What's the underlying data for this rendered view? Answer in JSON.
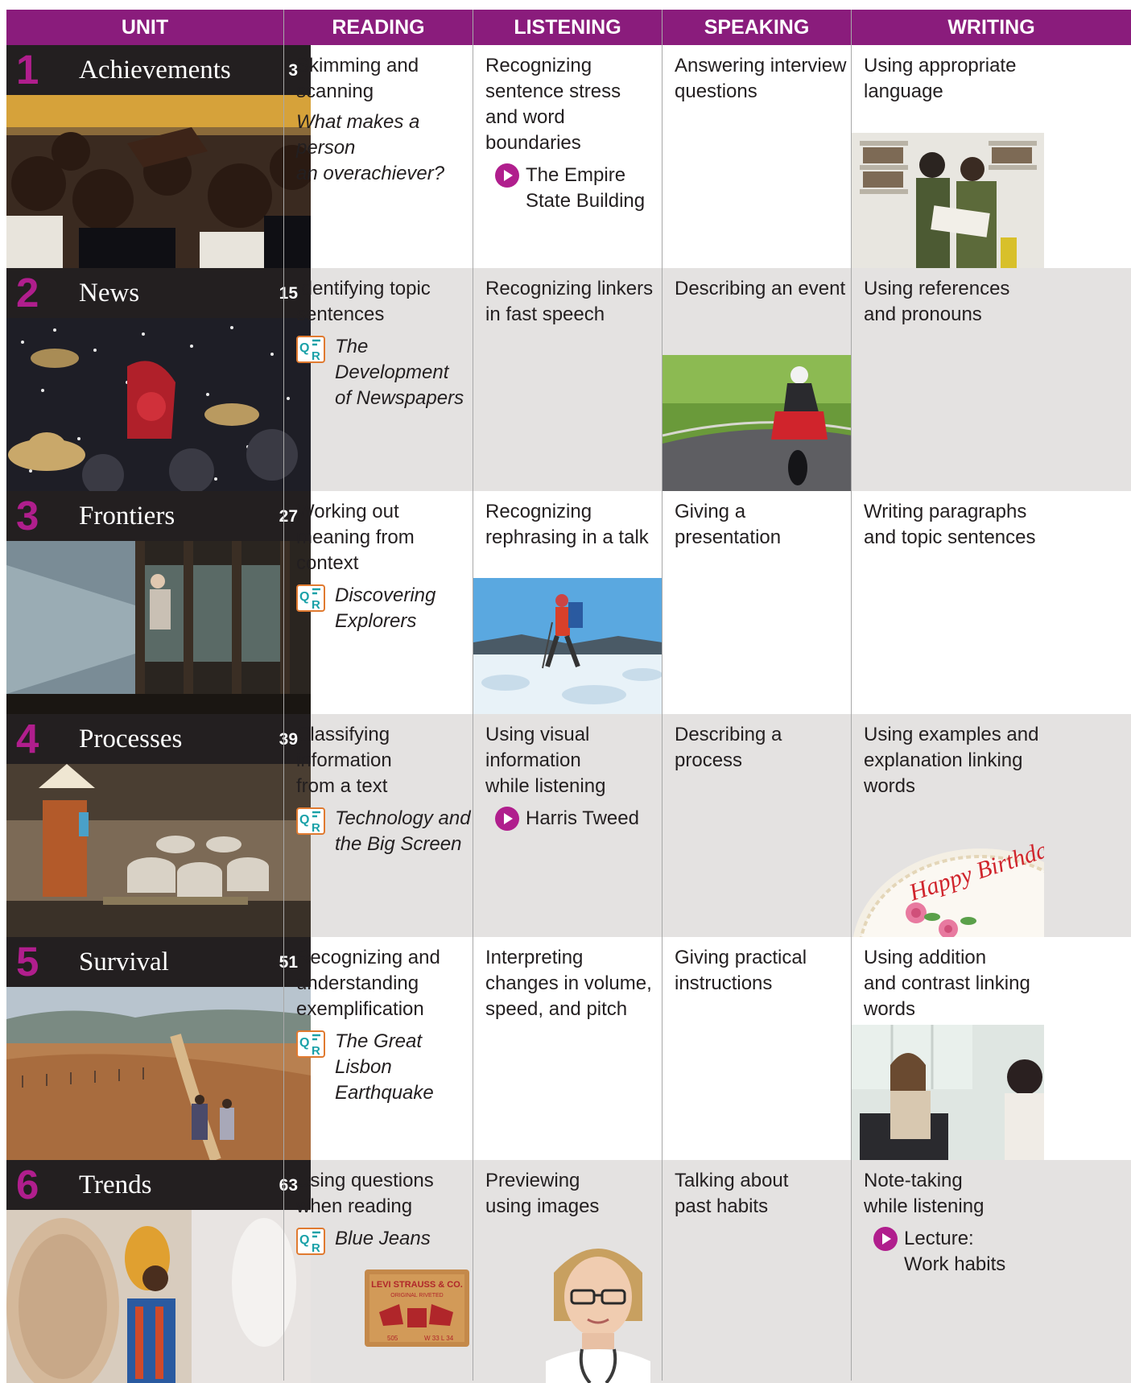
{
  "columns": [
    "UNIT",
    "READING",
    "LISTENING",
    "SPEAKING",
    "WRITING"
  ],
  "units": [
    {
      "number": "1",
      "title": "Achievements",
      "page": "3",
      "reading": {
        "skill": [
          "Skimming and",
          "scanning"
        ],
        "italic": [
          "What makes a person",
          "an overachiever?"
        ],
        "qr": []
      },
      "listening": {
        "skill": [
          "Recognizing",
          "sentence stress",
          "and word",
          "boundaries"
        ],
        "video": [
          "The Empire",
          "State Building"
        ]
      },
      "speaking": {
        "skill": [
          "Answering interview",
          "questions"
        ]
      },
      "writing": {
        "skill": [
          "Using appropriate",
          "language"
        ],
        "video": []
      }
    },
    {
      "number": "2",
      "title": "News",
      "page": "15",
      "reading": {
        "skill": [
          "Identifying topic",
          "sentences"
        ],
        "italic": [],
        "qr": [
          "The",
          "Development",
          "of Newspapers"
        ]
      },
      "listening": {
        "skill": [
          "Recognizing linkers",
          "in fast speech"
        ],
        "video": []
      },
      "speaking": {
        "skill": [
          "Describing an event"
        ]
      },
      "writing": {
        "skill": [
          "Using references",
          "and pronouns"
        ],
        "video": []
      }
    },
    {
      "number": "3",
      "title": "Frontiers",
      "page": "27",
      "reading": {
        "skill": [
          "Working out",
          "meaning from",
          "context"
        ],
        "italic": [],
        "qr": [
          "Discovering",
          "Explorers"
        ]
      },
      "listening": {
        "skill": [
          "Recognizing",
          "rephrasing in a talk"
        ],
        "video": []
      },
      "speaking": {
        "skill": [
          "Giving a",
          "presentation"
        ]
      },
      "writing": {
        "skill": [
          "Writing paragraphs",
          "and topic sentences"
        ],
        "video": []
      }
    },
    {
      "number": "4",
      "title": "Processes",
      "page": "39",
      "reading": {
        "skill": [
          "Classifying",
          "information",
          "from a text"
        ],
        "italic": [],
        "qr": [
          "Technology and",
          "the Big Screen"
        ]
      },
      "listening": {
        "skill": [
          "Using visual",
          "information",
          "while listening"
        ],
        "video": [
          "Harris Tweed"
        ]
      },
      "speaking": {
        "skill": [
          "Describing a process"
        ]
      },
      "writing": {
        "skill": [
          "Using examples and",
          "explanation linking",
          "words"
        ],
        "video": []
      }
    },
    {
      "number": "5",
      "title": "Survival",
      "page": "51",
      "reading": {
        "skill": [
          "Recognizing and",
          "understanding",
          "exemplification"
        ],
        "italic": [],
        "qr": [
          "The Great Lisbon",
          "Earthquake"
        ]
      },
      "listening": {
        "skill": [
          "Interpreting",
          "changes in volume,",
          "speed, and pitch"
        ],
        "video": []
      },
      "speaking": {
        "skill": [
          "Giving practical",
          "instructions"
        ]
      },
      "writing": {
        "skill": [
          "Using addition",
          "and contrast linking",
          "words"
        ],
        "video": []
      }
    },
    {
      "number": "6",
      "title": "Trends",
      "page": "63",
      "reading": {
        "skill": [
          "Using questions",
          "when reading"
        ],
        "italic": [],
        "qr": [
          "Blue Jeans"
        ]
      },
      "listening": {
        "skill": [
          "Previewing",
          "using images"
        ],
        "video": []
      },
      "speaking": {
        "skill": [
          "Talking about",
          "past habits"
        ]
      },
      "writing": {
        "skill": [
          "Note-taking",
          "while listening"
        ],
        "video": [
          "Lecture:",
          "Work habits"
        ]
      }
    }
  ],
  "label_text": {
    "levi_brand": "LEVI STRAUSS & CO.",
    "levi_sub": "ORIGINAL RIVETED",
    "levi_size": "505",
    "levi_size2": "W 33 L 34",
    "cake_text": "Happy Birthday"
  },
  "colors": {
    "header_bg": "#8a1c7c",
    "unit_number": "#b01e8d",
    "unit_bar": "#231f20",
    "shaded_row": "#e4e2e1",
    "qr_icon": "#1aa1a8",
    "play_icon": "#b01e8d"
  }
}
